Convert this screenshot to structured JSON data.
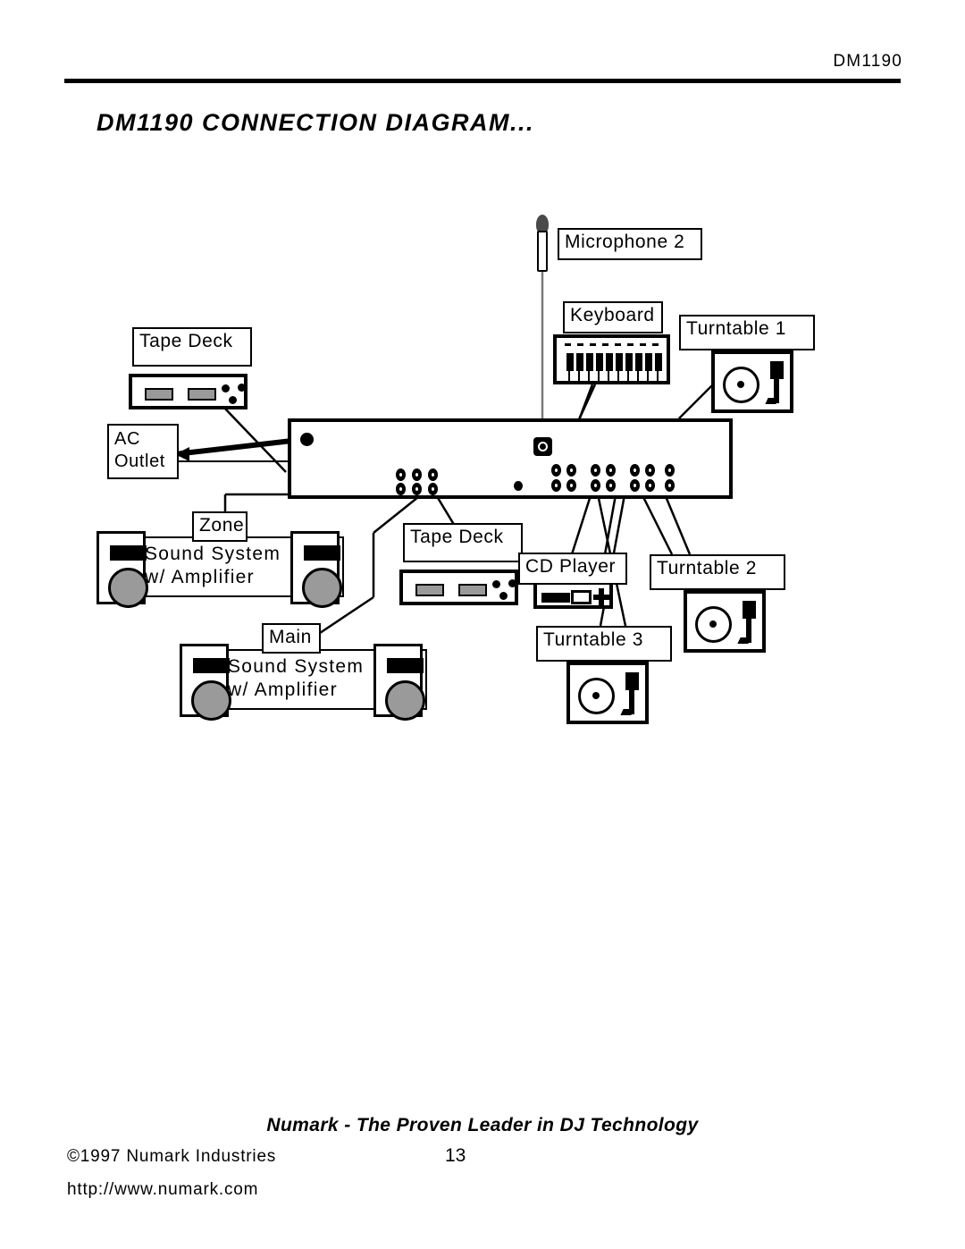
{
  "header": {
    "model": "DM1190"
  },
  "title": "DM1190 CONNECTION DIAGRAM...",
  "diagram": {
    "labels": {
      "microphone2": "Microphone 2",
      "keyboard": "Keyboard",
      "turntable1": "Turntable 1",
      "turntable2": "Turntable 2",
      "turntable3": "Turntable 3",
      "tape_deck_left": "Tape Deck",
      "tape_deck_center": "Tape Deck",
      "ac_outlet": "AC\nOutlet",
      "ac_outlet_line1": "AC",
      "ac_outlet_line2": "Outlet",
      "zone": "Zone",
      "main": "Main",
      "sound_system_line1": "Sound System",
      "sound_system_line2": "w/ Amplifier",
      "cd_player": "CD Player"
    }
  },
  "footer": {
    "tagline": "Numark - The Proven Leader in DJ Technology",
    "copyright": "©1997 Numark Industries",
    "page_number": "13",
    "url": "http://www.numark.com"
  },
  "colors": {
    "ink": "#000000",
    "paper": "#ffffff",
    "gray_part": "#9a9a9a",
    "mic_head": "#4a4a4a"
  }
}
